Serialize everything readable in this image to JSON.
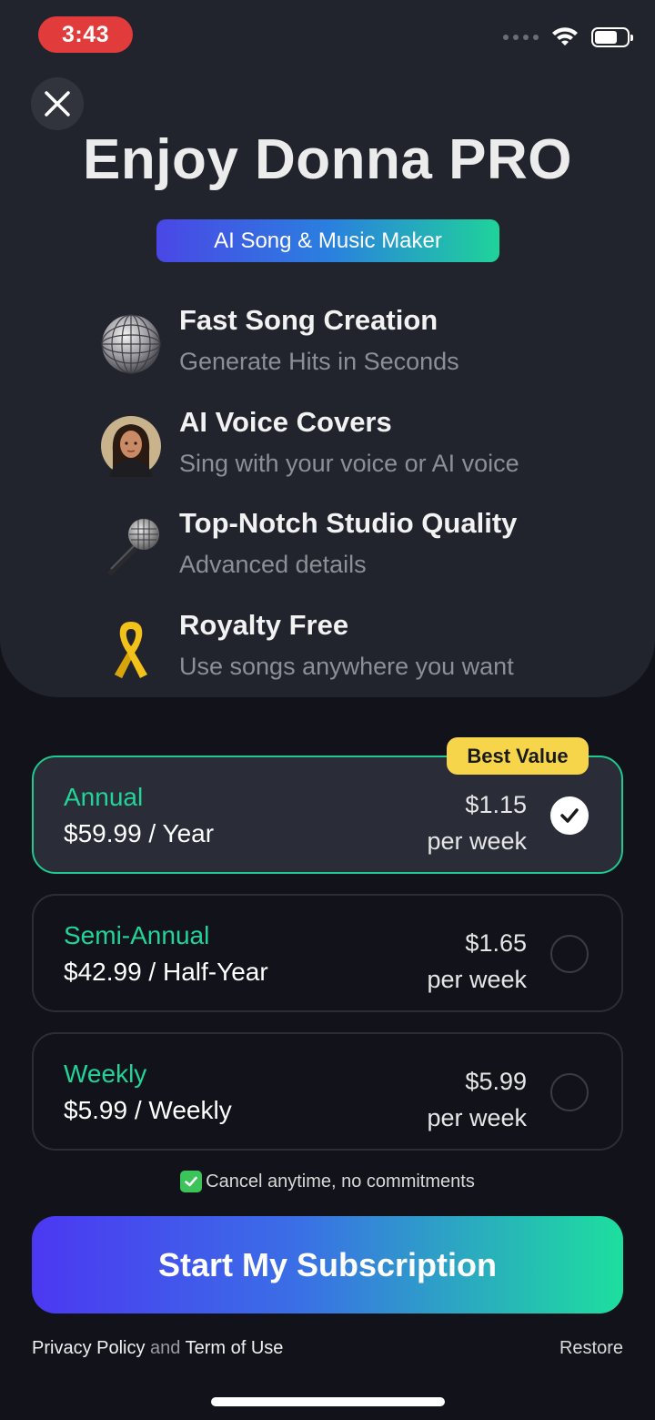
{
  "status_bar": {
    "time": "3:43"
  },
  "header": {
    "title": "Enjoy Donna PRO",
    "tag": "AI Song & Music Maker"
  },
  "features": [
    {
      "icon": "disco-ball-icon",
      "title": "Fast Song Creation",
      "subtitle": "Generate Hits in Seconds"
    },
    {
      "icon": "avatar-icon",
      "title": "AI Voice Covers",
      "subtitle": "Sing with your voice or AI voice"
    },
    {
      "icon": "microphone-icon",
      "title": "Top-Notch Studio Quality",
      "subtitle": "Advanced details"
    },
    {
      "icon": "ribbon-icon",
      "title": "Royalty Free",
      "subtitle": "Use songs anywhere you want"
    }
  ],
  "plans": [
    {
      "name": "Annual",
      "price": "$59.99 / Year",
      "weekly": "$1.15",
      "per": "per week",
      "selected": true,
      "badge": "Best Value"
    },
    {
      "name": "Semi-Annual",
      "price": "$42.99 / Half-Year",
      "weekly": "$1.65",
      "per": "per week",
      "selected": false
    },
    {
      "name": "Weekly",
      "price": "$5.99 / Weekly",
      "weekly": "$5.99",
      "per": "per week",
      "selected": false
    }
  ],
  "cancel_note": "Cancel anytime, no commitments",
  "cta_label": "Start My Subscription",
  "footer": {
    "privacy": "Privacy Policy",
    "and": "and",
    "terms": "Term of Use",
    "restore": "Restore"
  },
  "colors": {
    "accent_green": "#22d497",
    "badge_yellow": "#f6d54a",
    "status_red": "#e23b3b"
  }
}
